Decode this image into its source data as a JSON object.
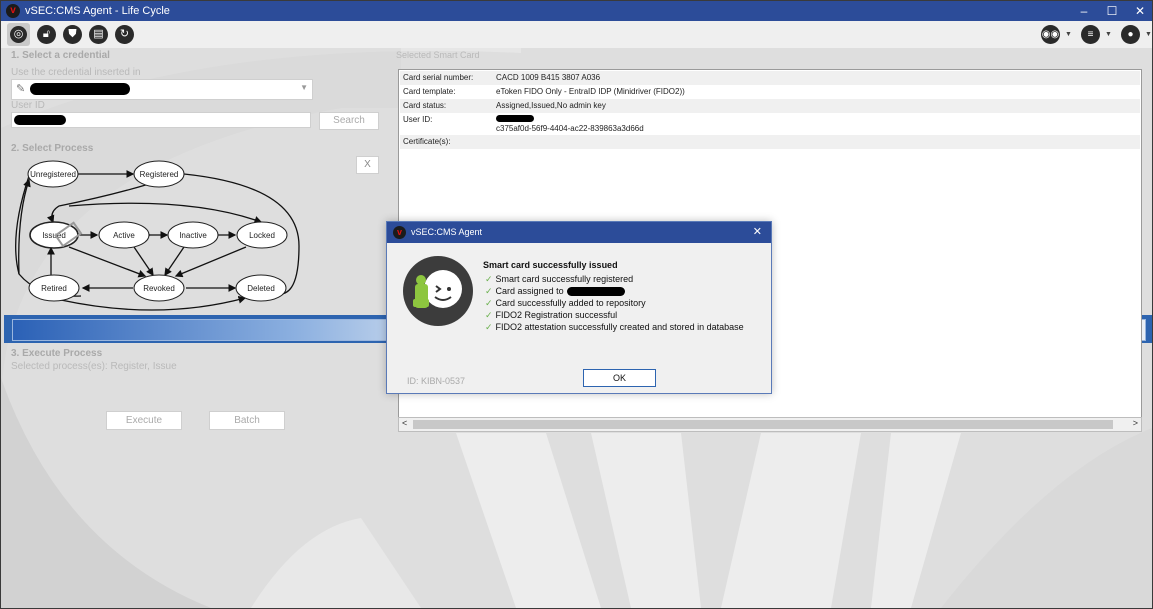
{
  "app": {
    "title": "vSEC:CMS Agent - Life Cycle"
  },
  "window_controls": {
    "minimize": "–",
    "maximize": "☐",
    "close": "✕"
  },
  "toolbar": {
    "icons": [
      "settings-icon",
      "lock-icon",
      "shield-icon",
      "card-icon",
      "refresh-icon"
    ],
    "right_icons": [
      "glasses-icon",
      "menu-icon",
      "user-icon"
    ]
  },
  "section1": {
    "title": "1. Select a credential",
    "use_label": "Use the credential inserted in",
    "user_id_label": "User ID",
    "search_label": "Search"
  },
  "section2": {
    "title": "2. Select Process",
    "close_label": "X",
    "states": {
      "unregistered": "Unregistered",
      "registered": "Registered",
      "issued": "Issued",
      "active": "Active",
      "inactive": "Inactive",
      "locked": "Locked",
      "retired": "Retired",
      "revoked": "Revoked",
      "deleted": "Deleted"
    }
  },
  "section3": {
    "title": "3. Execute Process",
    "selected": "Selected process(es): Register, Issue",
    "execute_label": "Execute",
    "batch_label": "Batch"
  },
  "card_panel": {
    "title": "Selected Smart Card",
    "rows": [
      {
        "key": "Card serial number:",
        "value": "CACD 1009 B415 3807 A036"
      },
      {
        "key": "Card template:",
        "value": "eToken FIDO Only - EntraID IDP (Minidriver (FIDO2))"
      },
      {
        "key": "Card status:",
        "value": "Assigned,Issued,No admin key"
      },
      {
        "key": "User ID:",
        "value": "c375af0d-56f9-4404-ac22-839863a3d66d"
      },
      {
        "key": "Certificate(s):",
        "value": ""
      }
    ]
  },
  "dialog": {
    "title": "vSEC:CMS Agent",
    "heading": "Smart card successfully issued",
    "lines": [
      "Smart card successfully registered",
      "Card assigned to",
      "Card successfully added to repository",
      "FIDO2 Registration successful",
      "FIDO2 attestation successfully created and stored in database"
    ],
    "id_text": "ID: KIBN-0537",
    "ok_label": "OK",
    "close_label": "✕"
  },
  "colors": {
    "titlebar": "#2c4c99",
    "progress": "#2d64b0",
    "check": "#6ab04c"
  }
}
